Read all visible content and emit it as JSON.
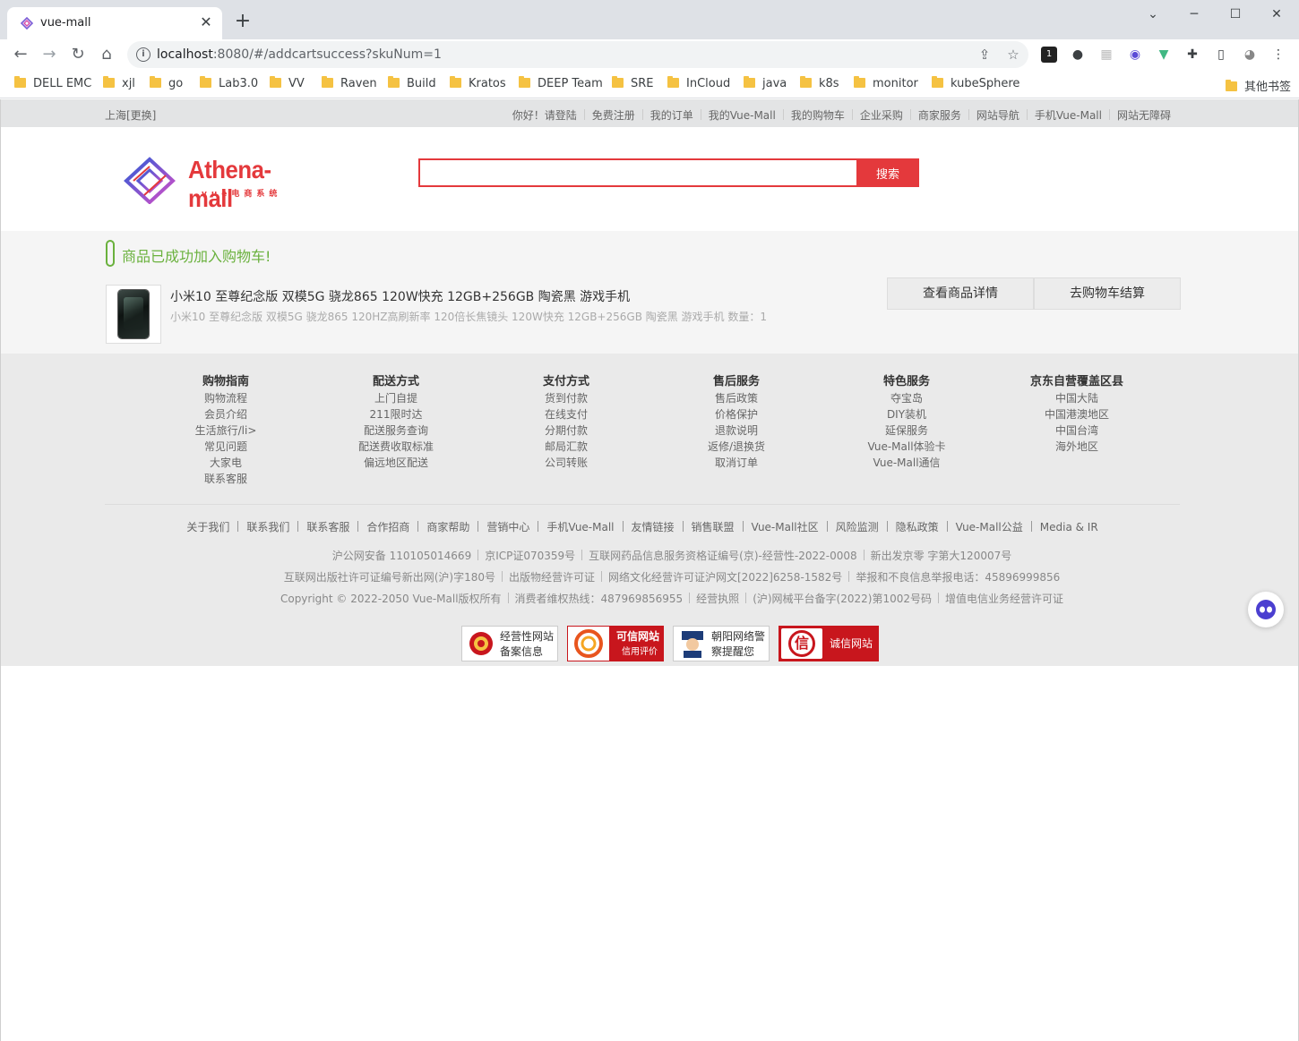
{
  "browser": {
    "tab_title": "vue-mall",
    "tab_close": "✕",
    "new_tab": "+",
    "window": {
      "minimize": "⌄",
      "min2": "─",
      "maximize": "☐",
      "close": "✕"
    },
    "url_host": "localhost",
    "url_rest": ":8080/#/addcartsuccess?skuNum=1",
    "ext_badge": "1",
    "bookmarks": [
      "DELL EMC",
      "xjl",
      "go",
      "Lab3.0",
      "VV",
      "Raven",
      "Build",
      "Kratos",
      "DEEP Team",
      "SRE",
      "InCloud",
      "java",
      "k8s",
      "monitor",
      "kubeSphere"
    ],
    "other_bookmarks": "其他书签"
  },
  "topbar": {
    "city": "上海[更换]",
    "links": [
      "你好！请登陆",
      "免费注册",
      "我的订单",
      "我的Vue-Mall",
      "我的购物车",
      "企业采购",
      "商家服务",
      "网站导航",
      "手机Vue-Mall",
      "网站无障碍"
    ]
  },
  "header": {
    "brand": "Athena-mall",
    "brand_sub": "vue电商系统",
    "search_placeholder": "",
    "search_button": "搜索"
  },
  "success": {
    "message": "商品已成功加入购物车!",
    "product_title": "小米10 至尊纪念版 双模5G 骁龙865 120W快充 12GB+256GB 陶瓷黑 游戏手机",
    "product_desc": "小米10 至尊纪念版 双模5G 骁龙865 120HZ高刷新率 120倍长焦镜头 120W快充 12GB+256GB 陶瓷黑 游戏手机 数量：1",
    "btn_detail": "查看商品详情",
    "btn_cart": "去购物车结算"
  },
  "footer": {
    "columns": [
      {
        "title": "购物指南",
        "items": [
          "购物流程",
          "会员介绍",
          "生活旅行/li>",
          "常见问题",
          "大家电",
          "联系客服"
        ]
      },
      {
        "title": "配送方式",
        "items": [
          "上门自提",
          "211限时达",
          "配送服务查询",
          "配送费收取标准",
          "偏远地区配送"
        ]
      },
      {
        "title": "支付方式",
        "items": [
          "货到付款",
          "在线支付",
          "分期付款",
          "邮局汇款",
          "公司转账"
        ]
      },
      {
        "title": "售后服务",
        "items": [
          "售后政策",
          "价格保护",
          "退款说明",
          "返修/退换货",
          "取消订单"
        ]
      },
      {
        "title": "特色服务",
        "items": [
          "夺宝岛",
          "DIY装机",
          "延保服务",
          "Vue-Mall体验卡",
          "Vue-Mall通信"
        ]
      },
      {
        "title": "京东自营覆盖区县",
        "items": [
          "中国大陆",
          "中国港澳地区",
          "中国台湾",
          "海外地区"
        ]
      }
    ],
    "links": [
      "关于我们",
      "联系我们",
      "联系客服",
      "合作招商",
      "商家帮助",
      "营销中心",
      "手机Vue-Mall",
      "友情链接",
      "销售联盟",
      "Vue-Mall社区",
      "风险监测",
      "隐私政策",
      "Vue-Mall公益",
      "Media & IR"
    ],
    "line1": [
      "沪公网安备 110105014669",
      "京ICP证070359号",
      "互联网药品信息服务资格证编号(京)-经营性-2022-0008",
      "新出发京零 字第大120007号"
    ],
    "line2": [
      "互联网出版社许可证编号新出网(沪)字180号",
      "出版物经营许可证",
      "网络文化经营许可证沪网文[2022]6258-1582号",
      "举报和不良信息举报电话：45896999856"
    ],
    "line3": [
      "Copyright © 2022-2050 Vue-Mall版权所有",
      "消费者维权热线：487969856955",
      "经营执照",
      "(沪)网械平台备字(2022)第1002号码",
      "增值电信业务经营许可证"
    ],
    "badges": {
      "b1_l1": "经营性网站",
      "b1_l2": "备案信息",
      "b2_l1": "可信网站",
      "b2_l2": "信用评价",
      "b3_l1": "朝阳网络警",
      "b3_l2": "察提醒您",
      "b4": "诚信网站"
    }
  },
  "colors": {
    "accent": "#e4393c",
    "success": "#6ab13d"
  }
}
